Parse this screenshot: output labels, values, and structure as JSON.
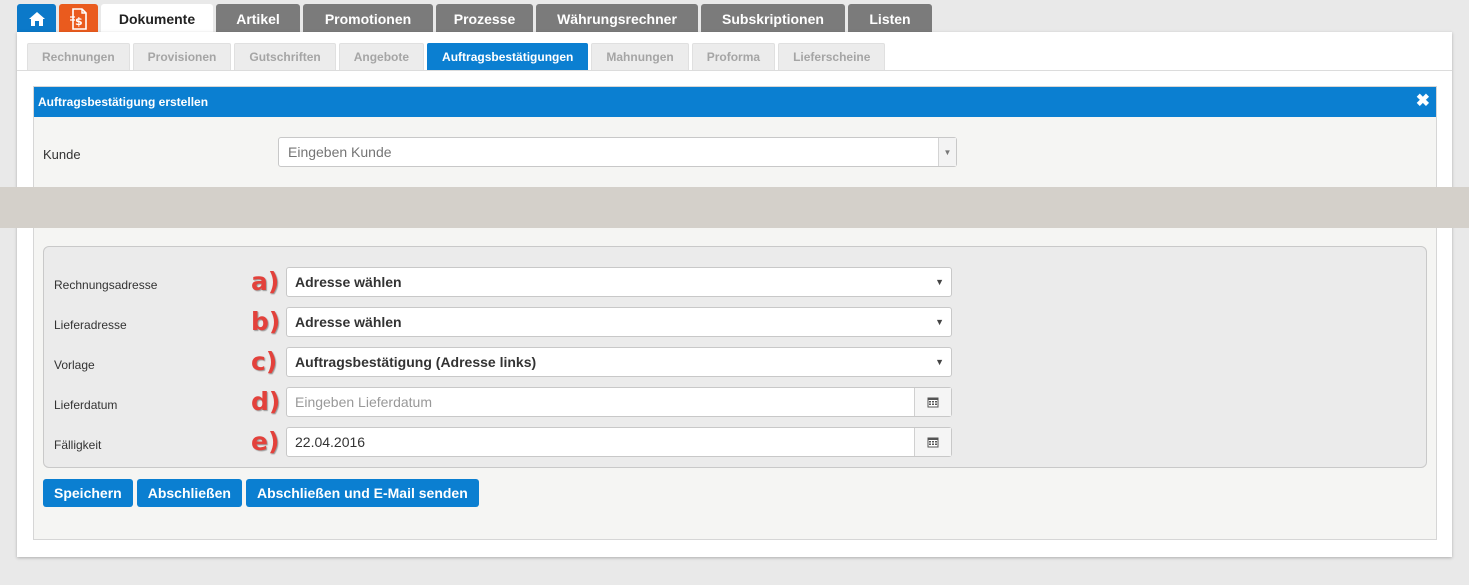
{
  "main_tabs": [
    {
      "icon": "home-icon"
    },
    {
      "icon": "document-euro-icon"
    },
    {
      "label": "Dokumente",
      "active": true
    },
    {
      "label": "Artikel"
    },
    {
      "label": "Promotionen"
    },
    {
      "label": "Prozesse"
    },
    {
      "label": "Währungsrechner"
    },
    {
      "label": "Subskriptionen"
    },
    {
      "label": "Listen"
    }
  ],
  "sub_tabs": [
    {
      "label": "Rechnungen"
    },
    {
      "label": "Provisionen"
    },
    {
      "label": "Gutschriften"
    },
    {
      "label": "Angebote"
    },
    {
      "label": "Auftragsbestätigungen",
      "active": true
    },
    {
      "label": "Mahnungen"
    },
    {
      "label": "Proforma"
    },
    {
      "label": "Lieferscheine"
    }
  ],
  "dialog": {
    "title": "Auftragsbestätigung erstellen",
    "close_icon": "close-icon",
    "kunde": {
      "label": "Kunde",
      "placeholder": "Eingeben Kunde"
    }
  },
  "form": {
    "rechnungsadresse": {
      "label": "Rechnungsadresse",
      "marker": "a)",
      "value": "Adresse wählen"
    },
    "lieferadresse": {
      "label": "Lieferadresse",
      "marker": "b)",
      "value": "Adresse wählen"
    },
    "vorlage": {
      "label": "Vorlage",
      "marker": "c)",
      "value": "Auftragsbestätigung (Adresse links)"
    },
    "lieferdatum": {
      "label": "Lieferdatum",
      "marker": "d)",
      "placeholder": "Eingeben Lieferdatum",
      "value": ""
    },
    "faelligkeit": {
      "label": "Fälligkeit",
      "marker": "e)",
      "value": "22.04.2016"
    }
  },
  "buttons": {
    "save": "Speichern",
    "close": "Abschließen",
    "close_email": "Abschließen und E-Mail senden"
  },
  "colors": {
    "accent": "#0b7fd1",
    "orange": "#ea5b1e",
    "tab_gray": "#7b7b7b",
    "marker_red": "#e3413b"
  }
}
